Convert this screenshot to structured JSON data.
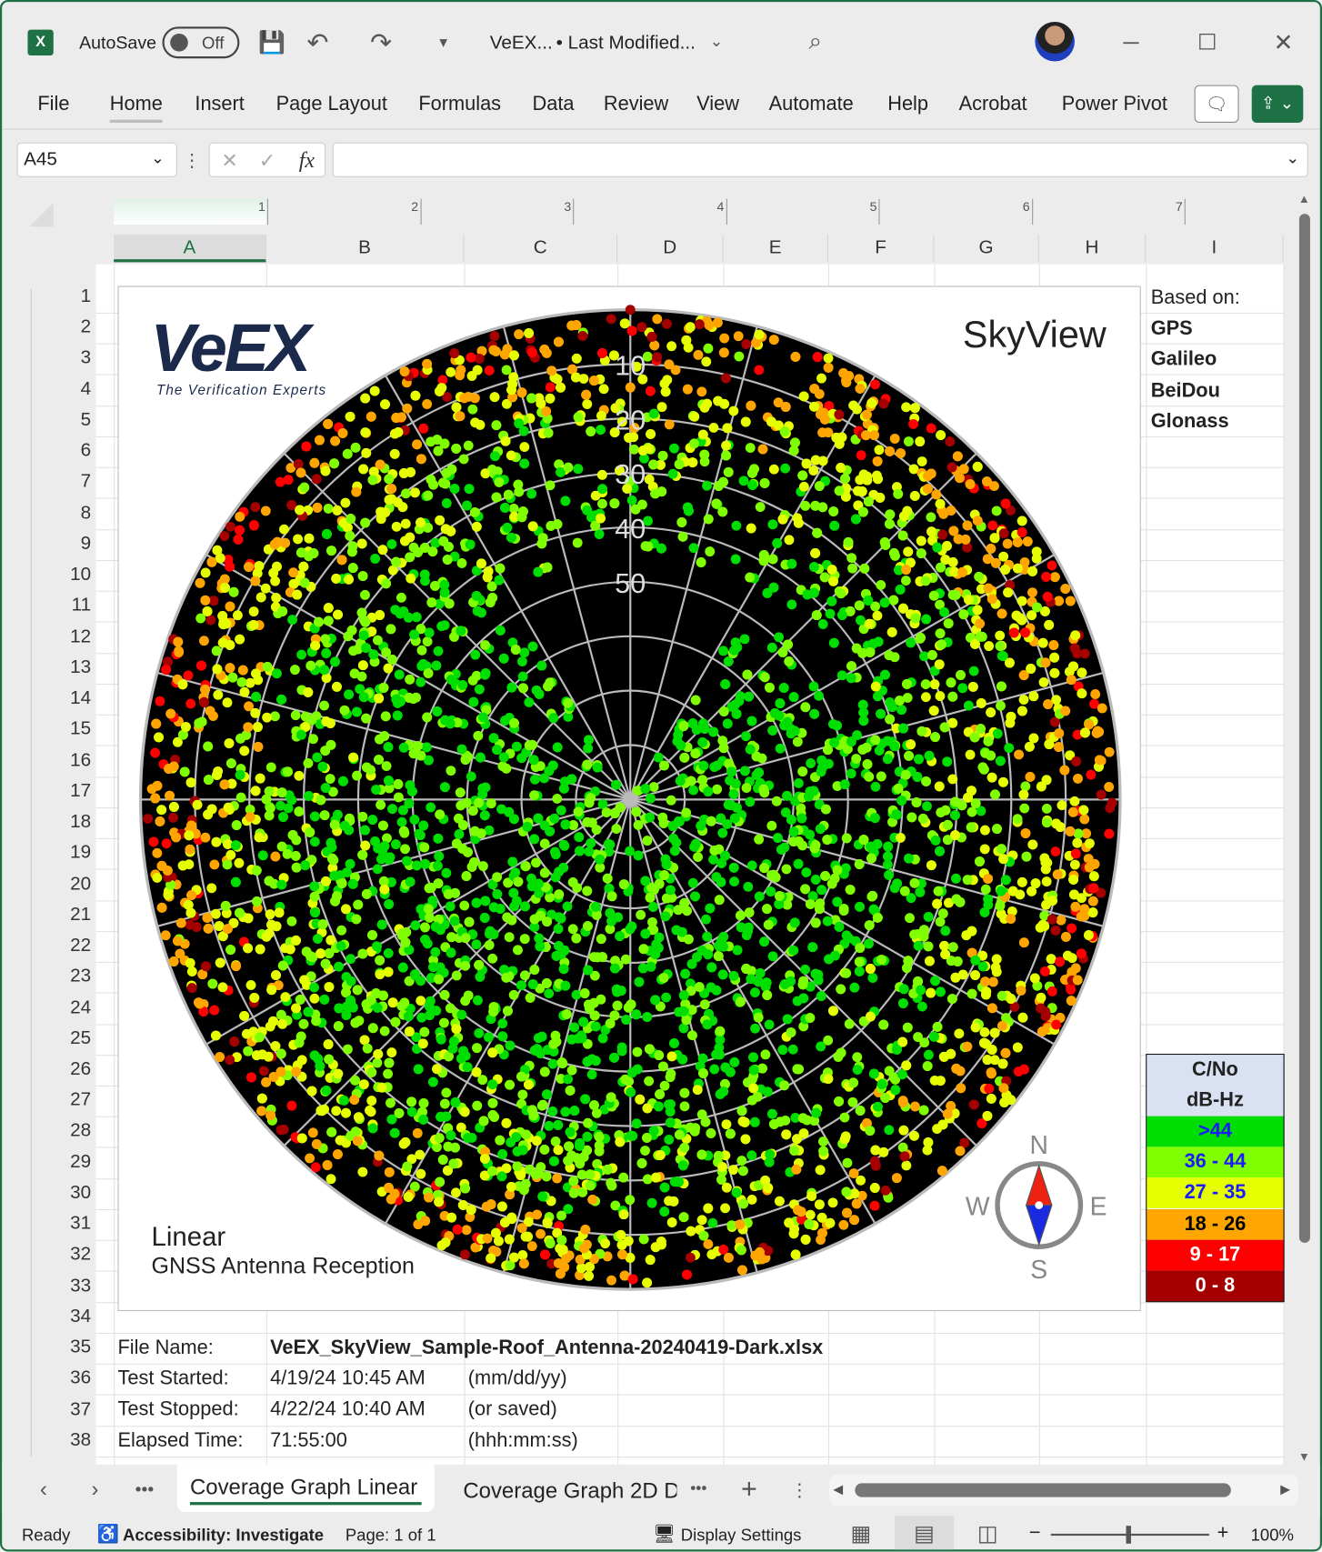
{
  "titlebar": {
    "autosave_label": "AutoSave",
    "autosave_state": "Off",
    "doc_title": "VeEX...",
    "modified": "• Last Modified...",
    "icons": [
      "excel-logo-icon",
      "save-icon",
      "undo-icon",
      "redo-icon",
      "customize-icon",
      "search-icon",
      "avatar",
      "minimize-icon",
      "maximize-icon",
      "close-icon"
    ]
  },
  "ribbon": {
    "tabs": [
      "File",
      "Home",
      "Insert",
      "Page Layout",
      "Formulas",
      "Data",
      "Review",
      "View",
      "Automate",
      "Help",
      "Acrobat",
      "Power Pivot"
    ],
    "active": "Home"
  },
  "formula_bar": {
    "name_box": "A45",
    "fx": "fx",
    "value": ""
  },
  "ruler": [
    "1",
    "2",
    "3",
    "4",
    "5",
    "6",
    "7"
  ],
  "columns": [
    "A",
    "B",
    "C",
    "D",
    "E",
    "F",
    "G",
    "H",
    "I"
  ],
  "rows": [
    "1",
    "2",
    "3",
    "4",
    "5",
    "6",
    "7",
    "8",
    "9",
    "10",
    "11",
    "12",
    "13",
    "14",
    "15",
    "16",
    "17",
    "18",
    "19",
    "20",
    "21",
    "22",
    "23",
    "24",
    "25",
    "26",
    "27",
    "28",
    "29",
    "30",
    "31",
    "32",
    "33",
    "34",
    "35",
    "36",
    "37",
    "38"
  ],
  "based_on": {
    "label": "Based on:",
    "systems": [
      "GPS",
      "Galileo",
      "BeiDou",
      "Glonass"
    ]
  },
  "chart": {
    "logo": "VeEX",
    "logo_tagline": "The Verification Experts",
    "title": "SkyView",
    "elevation_labels": [
      "10",
      "20",
      "30",
      "40",
      "50"
    ],
    "mode": "Linear",
    "subtitle": "GNSS Antenna Reception",
    "compass": {
      "n": "N",
      "s": "S",
      "e": "E",
      "w": "W"
    }
  },
  "legend": {
    "header1": "C/No",
    "header2": "dB-Hz",
    "bands": [
      {
        "label": ">44",
        "bg": "#00dd00",
        "fg": "#1a1aff"
      },
      {
        "label": "36 - 44",
        "bg": "#80ff00",
        "fg": "#1a1aff"
      },
      {
        "label": "27 - 35",
        "bg": "#e5ff00",
        "fg": "#1a1aff"
      },
      {
        "label": "18 - 26",
        "bg": "#ffa500",
        "fg": "#000000"
      },
      {
        "label": "9 - 17",
        "bg": "#ff0000",
        "fg": "#ffffff"
      },
      {
        "label": "0 - 8",
        "bg": "#a50000",
        "fg": "#ffffff"
      }
    ]
  },
  "info": [
    {
      "label": "File Name:",
      "value": "VeEX_SkyView_Sample-Roof_Antenna-20240419-Dark.xlsx",
      "note": ""
    },
    {
      "label": "Test Started:",
      "value": "4/19/24 10:45 AM",
      "note": "(mm/dd/yy)"
    },
    {
      "label": "Test Stopped:",
      "value": "4/22/24 10:40 AM",
      "note": "(or saved)"
    },
    {
      "label": "Elapsed Time:",
      "value": "71:55:00",
      "note": "(hhh:mm:ss)"
    }
  ],
  "sheets": {
    "tabs": [
      "Coverage Graph Linear",
      "Coverage Graph 2D D"
    ],
    "active": "Coverage Graph Linear"
  },
  "status": {
    "ready": "Ready",
    "accessibility": "Accessibility: Investigate",
    "page": "Page: 1 of 1",
    "display": "Display Settings",
    "zoom": "100%"
  }
}
